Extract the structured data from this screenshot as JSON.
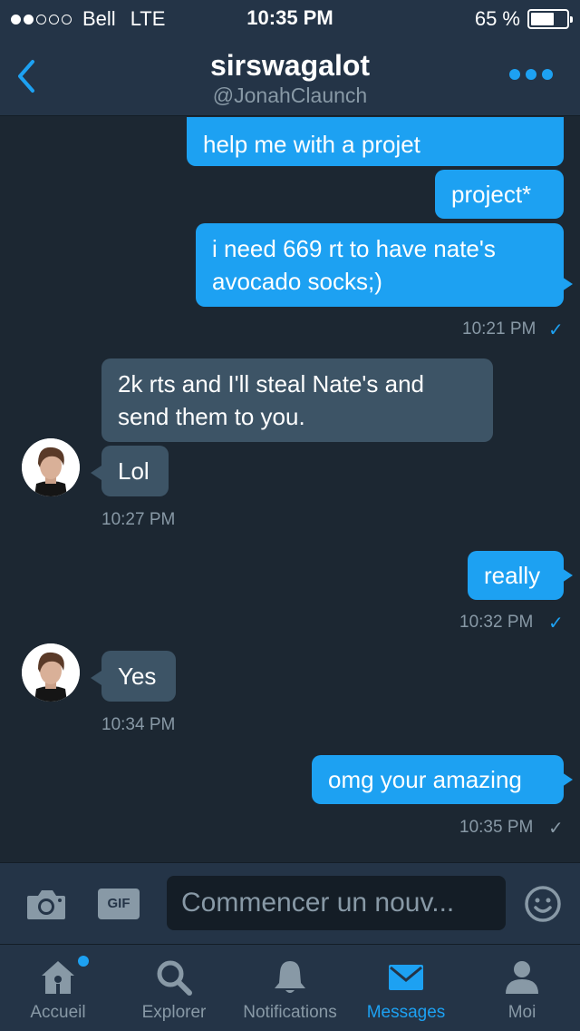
{
  "status_bar": {
    "carrier": "Bell",
    "network": "LTE",
    "time": "10:35 PM",
    "battery": "65 %",
    "battery_level": 0.65,
    "signal_bars": 2
  },
  "header": {
    "title": "sirswagalot",
    "subtitle": "@JonahClaunch"
  },
  "messages": [
    {
      "from": "me",
      "text": "help me with a projet"
    },
    {
      "from": "me",
      "text": "project*"
    },
    {
      "from": "me",
      "text_line1": "i need 669 rt to have nate's",
      "text_line2": "avocado socks;)",
      "time": "10:21 PM",
      "read": true
    },
    {
      "from": "them",
      "text_line1": "2k rts and I'll steal Nate's and",
      "text_line2": "send them to you."
    },
    {
      "from": "them",
      "text": "Lol",
      "time": "10:27 PM"
    },
    {
      "from": "me",
      "text": "really",
      "time": "10:32 PM",
      "read": true
    },
    {
      "from": "them",
      "text": "Yes",
      "time": "10:34 PM"
    },
    {
      "from": "me",
      "text": "omg your amazing",
      "time": "10:35 PM",
      "read": false
    }
  ],
  "composer": {
    "gif_label": "GIF",
    "placeholder": "Commencer un nouv..."
  },
  "tabs": [
    {
      "label": "Accueil",
      "icon": "home-icon",
      "has_badge": true
    },
    {
      "label": "Explorer",
      "icon": "search-icon"
    },
    {
      "label": "Notifications",
      "icon": "bell-icon"
    },
    {
      "label": "Messages",
      "icon": "mail-icon",
      "active": true
    },
    {
      "label": "Moi",
      "icon": "person-icon"
    }
  ],
  "colors": {
    "background": "#1c2732",
    "bar_background": "#243447",
    "accent": "#1da1f2",
    "incoming_bubble": "#3d5466",
    "muted_text": "#8899a6"
  }
}
